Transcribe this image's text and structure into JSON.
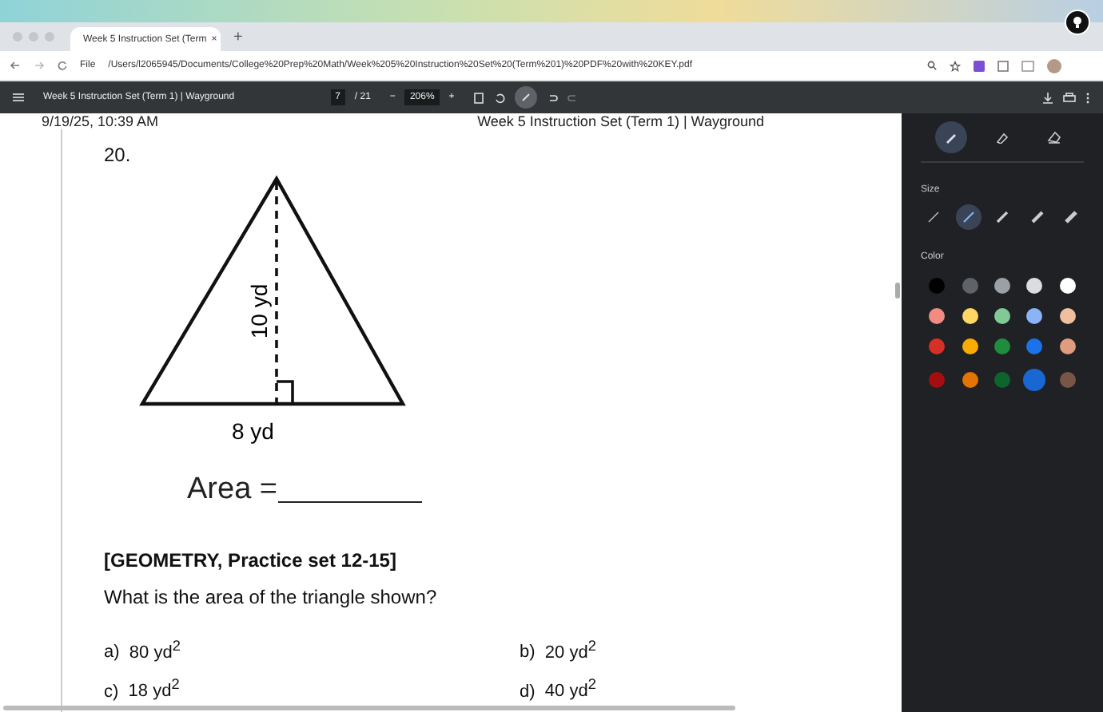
{
  "browser": {
    "tab_title": "Week 5 Instruction Set (Term",
    "tab_close": "×",
    "new_tab": "+",
    "file_chip": "File",
    "url": "/Users/l2065945/Documents/College%20Prep%20Math/Week%205%20Instruction%20Set%20(Term%201)%20PDF%20with%20KEY.pdf"
  },
  "pdf_toolbar": {
    "title": "Week 5 Instruction Set (Term 1) | Wayground",
    "page": "7",
    "pages": "/ 21",
    "zoom_out": "−",
    "zoom": "206%",
    "zoom_in": "+"
  },
  "page_header": {
    "left": "9/19/25, 10:39 AM",
    "right": "Week 5 Instruction Set (Term 1) | Wayground"
  },
  "question": {
    "number": "20.",
    "height_label": "10 yd",
    "base_label": "8 yd",
    "area_label": "Area =",
    "section": "[GEOMETRY, Practice set 12-15]",
    "prompt": "What is the area of the triangle shown?",
    "choices": [
      {
        "letter": "a)",
        "text": "80 yd$^{2}$"
      },
      {
        "letter": "b)",
        "text": "20 yd$^{2}$"
      },
      {
        "letter": "c)",
        "text": "18 yd$^{2}$"
      },
      {
        "letter": "d)",
        "text": "40 yd$^{2}$"
      }
    ]
  },
  "annotation_panel": {
    "tools": [
      {
        "kind": "pen",
        "selected": true
      },
      {
        "kind": "highlighter",
        "selected": false
      },
      {
        "kind": "eraser",
        "selected": false
      }
    ],
    "size_label": "Size",
    "sizes": [
      {
        "selected": false
      },
      {
        "selected": true
      },
      {
        "selected": false
      },
      {
        "selected": false
      },
      {
        "selected": false
      }
    ],
    "color_label": "Color",
    "colors": [
      {
        "color": "#000000",
        "selected": false
      },
      {
        "color": "#5f6368",
        "selected": false
      },
      {
        "color": "#9aa0a6",
        "selected": false
      },
      {
        "color": "#dadce0",
        "selected": false
      },
      {
        "color": "#ffffff",
        "selected": false
      },
      {
        "color": "#f28b82",
        "selected": false
      },
      {
        "color": "#fdd663",
        "selected": false
      },
      {
        "color": "#81c995",
        "selected": false
      },
      {
        "color": "#8ab4f8",
        "selected": false
      },
      {
        "color": "#f0bf9f",
        "selected": false
      },
      {
        "color": "#d93025",
        "selected": false
      },
      {
        "color": "#f9ab00",
        "selected": false
      },
      {
        "color": "#1e8e3e",
        "selected": false
      },
      {
        "color": "#1a73e8",
        "selected": false
      },
      {
        "color": "#e09c7e",
        "selected": false
      },
      {
        "color": "#a50e0e",
        "selected": false
      },
      {
        "color": "#e37400",
        "selected": false
      },
      {
        "color": "#0d652d",
        "selected": false
      },
      {
        "color": "#1967d2",
        "selected": true
      },
      {
        "color": "#795548",
        "selected": false
      }
    ]
  }
}
